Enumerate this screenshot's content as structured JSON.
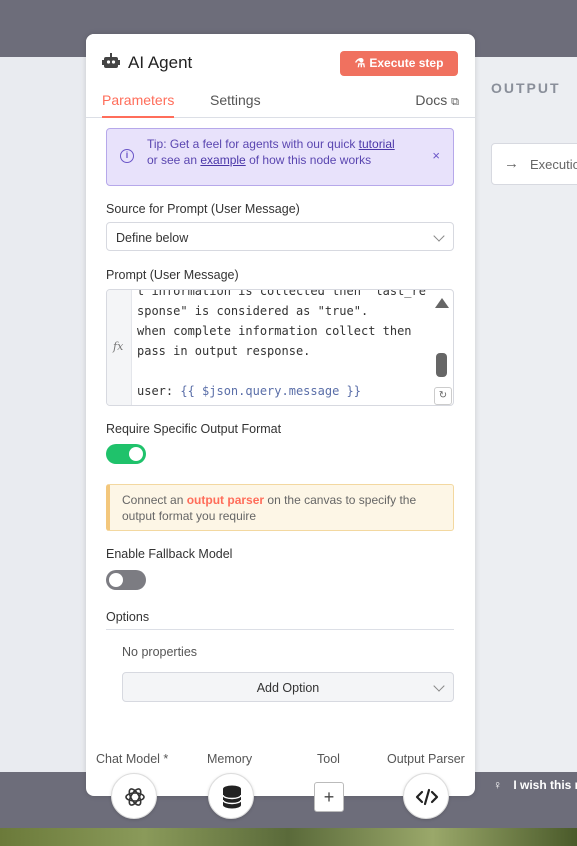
{
  "node": {
    "title": "AI Agent",
    "execute_label": "Execute step"
  },
  "tabs": [
    {
      "label": "Parameters"
    },
    {
      "label": "Settings"
    }
  ],
  "docs_label": "Docs",
  "tip": {
    "part1": "Tip: Get a feel for agents with our quick ",
    "link1": "tutorial",
    "part2": "or see an ",
    "link2": "example",
    "part3": " of how this node works",
    "close": "×"
  },
  "source": {
    "label": "Source for Prompt (User Message)",
    "value": "Define below"
  },
  "prompt": {
    "label": "Prompt (User Message)",
    "lines": [
      "t information is collected then \"last_re",
      "sponse\" is considered as \"true\".",
      "when complete information collect then",
      "pass in output response.",
      "",
      "user: "
    ],
    "template": "{{ $json.query.message }}",
    "fx": "fx"
  },
  "output_format": {
    "label": "Require Specific Output Format",
    "enabled": true
  },
  "warning": {
    "part1": "Connect an ",
    "highlight": "output parser",
    "part2": " on the canvas to specify the output format you require"
  },
  "fallback": {
    "label": "Enable Fallback Model",
    "enabled": false
  },
  "options": {
    "title": "Options",
    "empty": "No properties",
    "add_label": "Add Option"
  },
  "connectors": [
    {
      "label": "Chat Model *",
      "icon": "openai-icon"
    },
    {
      "label": "Memory",
      "icon": "database-icon"
    },
    {
      "label": "Tool",
      "icon": "plus-icon"
    },
    {
      "label": "Output Parser",
      "icon": "code-icon"
    }
  ],
  "output_panel": {
    "title": "OUTPUT",
    "execution_label": "Executio"
  },
  "feedback": {
    "text": "I wish this n"
  }
}
